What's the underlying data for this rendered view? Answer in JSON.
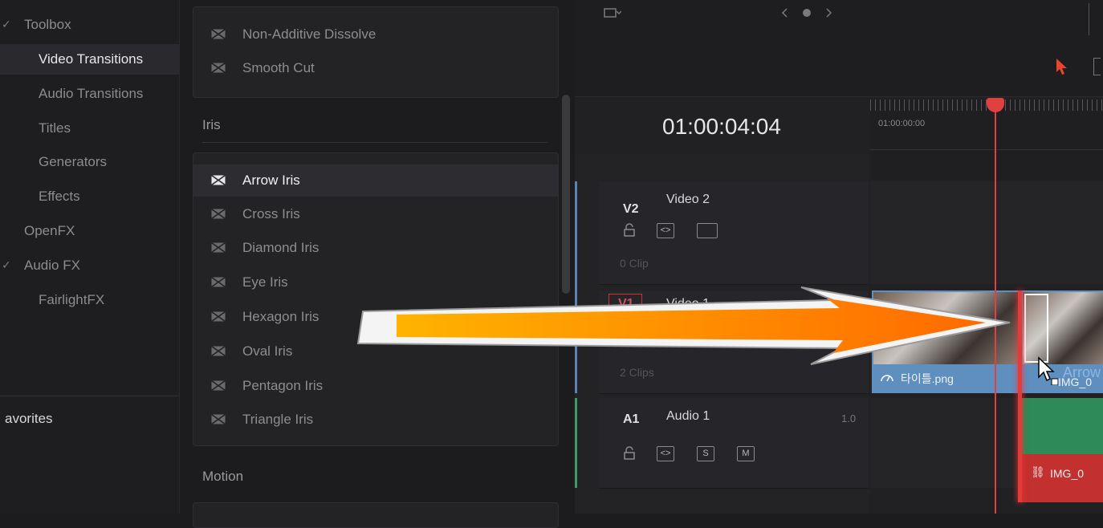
{
  "sidebar": {
    "items": [
      {
        "label": "Toolbox",
        "indent": 30,
        "chevron": true
      },
      {
        "label": "Video Transitions",
        "indent": 48,
        "selected": true
      },
      {
        "label": "Audio Transitions",
        "indent": 48
      },
      {
        "label": "Titles",
        "indent": 48
      },
      {
        "label": "Generators",
        "indent": 48
      },
      {
        "label": "Effects",
        "indent": 48
      },
      {
        "label": "OpenFX",
        "indent": 30
      },
      {
        "label": "Audio FX",
        "indent": 30,
        "chevron": true
      },
      {
        "label": "FairlightFX",
        "indent": 48
      }
    ],
    "favorites_label": "avorites"
  },
  "effects": {
    "dissolve_items": [
      "Non-Additive Dissolve",
      "Smooth Cut"
    ],
    "iris_header": "Iris",
    "iris_items": [
      "Arrow Iris",
      "Cross Iris",
      "Diamond Iris",
      "Eye Iris",
      "Hexagon Iris",
      "Oval Iris",
      "Pentagon Iris",
      "Triangle Iris"
    ],
    "iris_selected_index": 0,
    "motion_header": "Motion"
  },
  "timeline": {
    "timecode": "01:00:04:04",
    "ruler_label": "01:00:00:00",
    "tracks": [
      {
        "id": "V2",
        "name": "Video 2",
        "meta": "0 Clip"
      },
      {
        "id": "V1",
        "name": "Video 1",
        "meta": "2 Clips"
      },
      {
        "id": "A1",
        "name": "Audio 1",
        "level": "1.0"
      }
    ],
    "ctrl_s": "S",
    "ctrl_m": "M",
    "clips": {
      "title_clip": "타이틀.png",
      "img_clip_video": "IMG_0",
      "img_clip_audio": "IMG_0",
      "transition_label": "Arrow"
    }
  },
  "colors": {
    "accent": "#e04040",
    "video_clip": "#5e8fbf",
    "audio_clip": "#2e8a58",
    "arrow": "#ff8c00"
  }
}
